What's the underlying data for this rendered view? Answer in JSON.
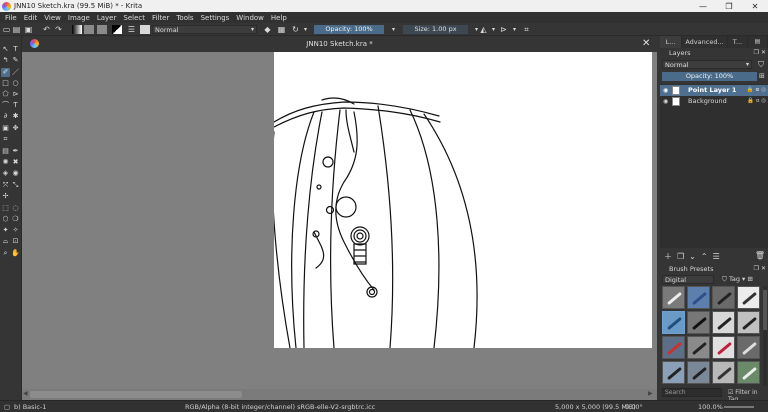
{
  "titlebar": {
    "title": "JNN10 Sketch.kra (99.5 MiB)  * - Krita",
    "minimize": "—",
    "maximize": "❐",
    "close": "✕"
  },
  "menubar": {
    "items": [
      "File",
      "Edit",
      "View",
      "Image",
      "Layer",
      "Select",
      "Filter",
      "Tools",
      "Settings",
      "Window",
      "Help"
    ]
  },
  "toolbar": {
    "blend_mode": "Normal",
    "opacity": "Opacity: 100%",
    "size": "Size: 1.00 px"
  },
  "document": {
    "tab_title": "JNN10 Sketch.kra *",
    "close": "✕"
  },
  "dock": {
    "tabs": [
      "L...",
      "Advanced...",
      "T..."
    ],
    "layers_title": "Layers",
    "layer_blend": "Normal",
    "layer_opacity": "Opacity:  100%",
    "layers": [
      {
        "name": "Point Layer 1",
        "active": true
      },
      {
        "name": "Background",
        "active": false
      }
    ],
    "presets_title": "Brush Presets",
    "preset_filter": "Digital",
    "preset_tag": "Tag",
    "search_placeholder": "Search",
    "filter_in_tag": "Filter in Tag"
  },
  "statusbar": {
    "brush": "b) Basic-1",
    "color_space": "RGB/Alpha (8-bit integer/channel)  sRGB-elle-V2-srgbtrc.icc",
    "dimensions": "5,000 x 5,000 (99.5 MiB)",
    "rotation": "0.00°",
    "zoom": "100.0%"
  },
  "colors": {
    "accent": "#4f6f8f",
    "canvas_bg": "#808080",
    "panel": "#353535"
  }
}
